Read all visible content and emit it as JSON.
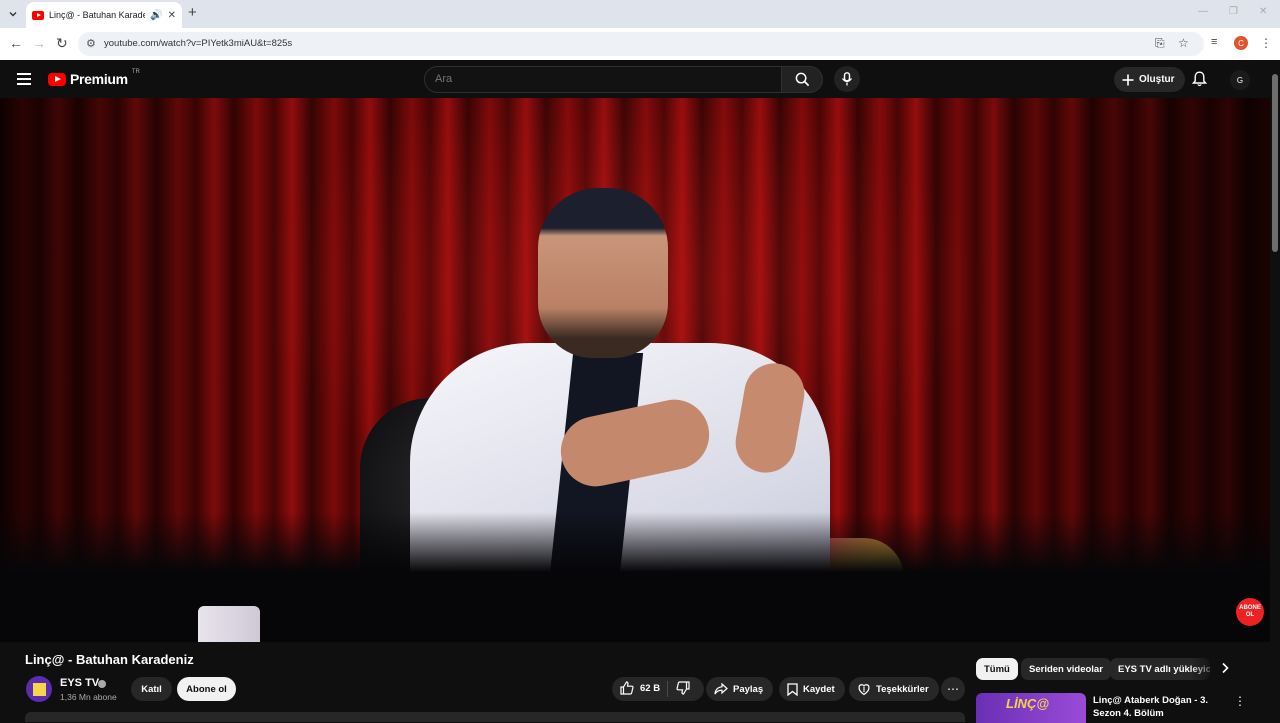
{
  "browser": {
    "tab": {
      "title": "Linç@ - Batuhan Karadeniz",
      "audio_icon": "speaker-icon",
      "close_icon": "close-icon"
    },
    "new_tab_label": "+",
    "url": "youtube.com/watch?v=PIYetk3miAU&t=825s",
    "profile_initial": "C"
  },
  "youtube": {
    "logo_text": "Premium",
    "logo_region": "TR",
    "search_placeholder": "Ara",
    "create_label": "Oluştur",
    "user_avatar_text": "G"
  },
  "video": {
    "title": "Linç@ - Batuhan Karadeniz",
    "overlay_badge": "ABONE OL"
  },
  "channel": {
    "name": "EYS TV",
    "subscribers": "1,36 Mn abone",
    "join_label": "Katıl",
    "subscribe_label": "Abone ol"
  },
  "actions": {
    "likes": "62 B",
    "share_label": "Paylaş",
    "save_label": "Kaydet",
    "thanks_label": "Teşekkürler",
    "more_label": "⋯"
  },
  "sidebar": {
    "chips": [
      "Tümü",
      "Seriden videolar",
      "EYS TV adlı yükleyici"
    ],
    "recommendation": {
      "thumb_text": "LİNÇ@",
      "title": "Linç@ Ataberk Doğan - 3. Sezon 4. Bölüm"
    }
  },
  "colors": {
    "brand_red": "#ff0000",
    "background": "#0f0f0f",
    "chip_bg": "#272727"
  }
}
